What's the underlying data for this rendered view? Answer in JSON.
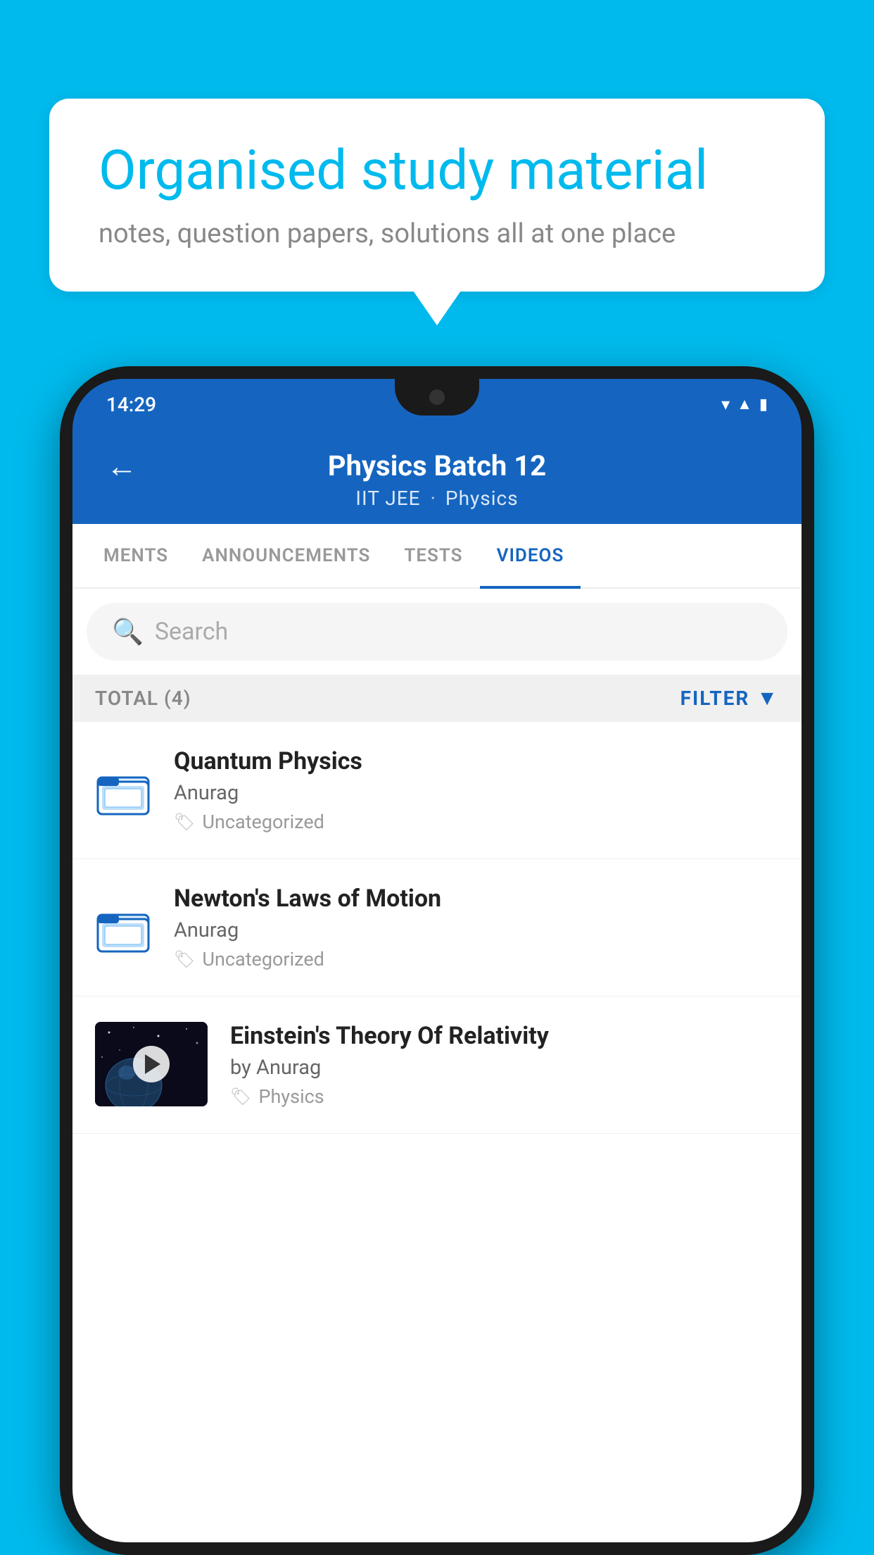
{
  "background_color": "#00BAED",
  "speech_bubble": {
    "heading": "Organised study material",
    "subtext": "notes, question papers, solutions all at one place"
  },
  "phone": {
    "time": "14:29",
    "header": {
      "back_label": "←",
      "title": "Physics Batch 12",
      "subtitle_part1": "IIT JEE",
      "subtitle_part2": "Physics"
    },
    "tabs": [
      {
        "label": "MENTS",
        "active": false
      },
      {
        "label": "ANNOUNCEMENTS",
        "active": false
      },
      {
        "label": "TESTS",
        "active": false
      },
      {
        "label": "VIDEOS",
        "active": true
      }
    ],
    "search": {
      "placeholder": "Search"
    },
    "filter": {
      "total_label": "TOTAL (4)",
      "button_label": "FILTER"
    },
    "videos": [
      {
        "title": "Quantum Physics",
        "author": "Anurag",
        "tag": "Uncategorized",
        "has_thumbnail": false
      },
      {
        "title": "Newton's Laws of Motion",
        "author": "Anurag",
        "tag": "Uncategorized",
        "has_thumbnail": false
      },
      {
        "title": "Einstein's Theory Of Relativity",
        "author": "by Anurag",
        "tag": "Physics",
        "has_thumbnail": true
      }
    ]
  }
}
